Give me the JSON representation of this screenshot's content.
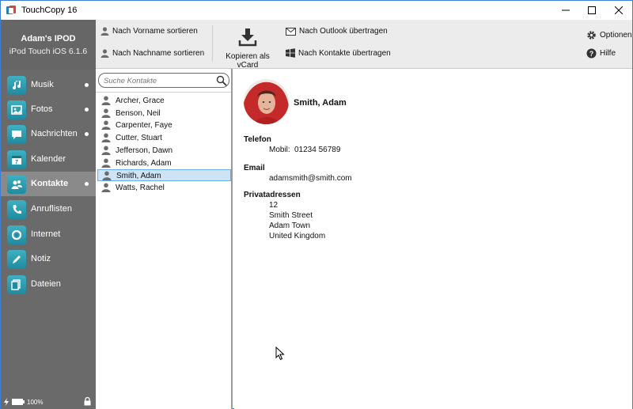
{
  "window": {
    "title": "TouchCopy 16"
  },
  "device": {
    "name": "Adam's IPOD",
    "model": "iPod Touch iOS 6.1.6"
  },
  "nav": [
    {
      "label": "Musik",
      "icon": "music-note-icon",
      "dot": true
    },
    {
      "label": "Fotos",
      "icon": "photos-icon",
      "dot": true
    },
    {
      "label": "Nachrichten",
      "icon": "speech-bubble-icon",
      "dot": true
    },
    {
      "label": "Kalender",
      "icon": "calendar-icon",
      "dot": false
    },
    {
      "label": "Kontakte",
      "icon": "contacts-icon",
      "dot": true,
      "active": true
    },
    {
      "label": "Anruflisten",
      "icon": "phone-icon",
      "dot": false
    },
    {
      "label": "Internet",
      "icon": "internet-icon",
      "dot": false
    },
    {
      "label": "Notiz",
      "icon": "pencil-icon",
      "dot": false
    },
    {
      "label": "Dateien",
      "icon": "files-icon",
      "dot": false
    }
  ],
  "status": {
    "battery": "100%"
  },
  "toolbar": {
    "sort_first": "Nach Vorname sortieren",
    "sort_last": "Nach Nachname sortieren",
    "vcard": "Kopieren als vCard",
    "outlook": "Nach Outlook übertragen",
    "contacts": "Nach Kontakte übertragen",
    "options": "Optionen",
    "help": "Hilfe"
  },
  "search": {
    "placeholder": "Suche Kontakte"
  },
  "contacts": [
    "Archer, Grace",
    "Benson, Neil",
    "Carpenter, Faye",
    "Cutter, Stuart",
    "Jefferson, Dawn",
    "Richards, Adam",
    "Smith, Adam",
    "Watts, Rachel"
  ],
  "selected_contact_index": 6,
  "detail": {
    "name": "Smith, Adam",
    "phone_heading": "Telefon",
    "phone_type": "Mobil:",
    "phone_number": "01234 56789",
    "email_heading": "Email",
    "email": "adamsmith@smith.com",
    "address_heading": "Privatadressen",
    "address": [
      "12",
      "Smith Street",
      "Adam Town",
      "United Kingdom"
    ]
  },
  "colors": {
    "accent": "#2a9db3",
    "selection": "#cde4f7",
    "sidebar": "#6a6a6a"
  }
}
